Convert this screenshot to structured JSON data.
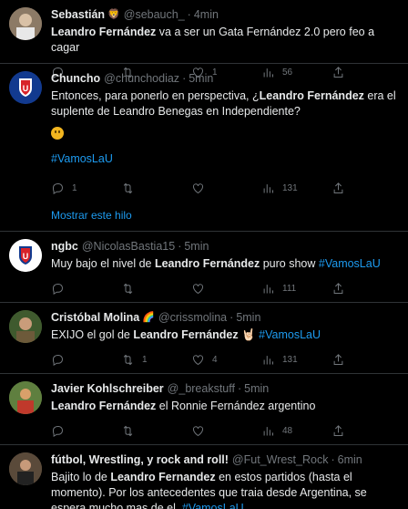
{
  "tweets": [
    {
      "name": "Sebastián",
      "emoji": "🦁",
      "handle": "@sebauch_",
      "time": "4min",
      "text_before": "",
      "bold": "Leandro Fernández",
      "text_after": " va a ser un Gata Fernández 2.0 pero feo a cagar",
      "hashtag": "",
      "replies": "",
      "retweets": "",
      "likes": "1",
      "views": "56",
      "avatar_color": "#7a6a5a"
    },
    {
      "name": "Chuncho",
      "emoji": "",
      "handle": "@chunchodiaz",
      "time": "5min",
      "text_before": "Entonces, para ponerlo en perspectiva, ¿",
      "bold": "Leandro Fernández",
      "text_after": " era el suplente de Leandro Benegas en Independiente?",
      "hashtag": "#VamosLaU",
      "replies": "1",
      "retweets": "",
      "likes": "",
      "views": "131",
      "avatar_color": "#1a3a8a"
    },
    {
      "name": "ngbc",
      "emoji": "",
      "handle": "@NicolasBastia15",
      "time": "5min",
      "text_before": "Muy bajo el nivel de ",
      "bold": "Leandro Fernández",
      "text_after": " puro show ",
      "hashtag": "#VamosLaU",
      "replies": "",
      "retweets": "",
      "likes": "",
      "views": "111",
      "avatar_color": "#ffffff"
    },
    {
      "name": "Cristóbal Molina",
      "emoji": "🌈",
      "handle": "@crissmolina",
      "time": "5min",
      "text_before": "EXIJO el gol de ",
      "bold": "Leandro Fernández",
      "text_after": " 🤘🏻 ",
      "hashtag": "#VamosLaU",
      "replies": "",
      "retweets": "1",
      "likes": "4",
      "views": "131",
      "avatar_color": "#4d6a3a"
    },
    {
      "name": "Javier Kohlschreiber",
      "emoji": "",
      "handle": "@_breakstuff",
      "time": "5min",
      "text_before": "",
      "bold": "Leandro Fernández",
      "text_after": " el Ronnie Fernández argentino",
      "hashtag": "",
      "replies": "",
      "retweets": "",
      "likes": "",
      "views": "48",
      "avatar_color": "#6a8a4a"
    },
    {
      "name": "fútbol, Wrestling, y rock and roll!",
      "emoji": "",
      "handle": "@Fut_Wrest_Rock",
      "time": "6min",
      "text_before": "Bajito lo de ",
      "bold": "Leandro Fernandez",
      "text_after": " en estos partidos (hasta el momento). Por los antecedentes que traia desde Argentina, se espera mucho mas de el. ",
      "hashtag": "#VamosLaU",
      "replies": "",
      "retweets": "",
      "likes": "",
      "views": "",
      "avatar_color": "#6a5a4a"
    }
  ],
  "show_thread": "Mostrar este hilo",
  "colors": {
    "accent": "#1d9bf0",
    "muted": "#71767b",
    "border": "#2f3336",
    "bg": "#000000"
  }
}
